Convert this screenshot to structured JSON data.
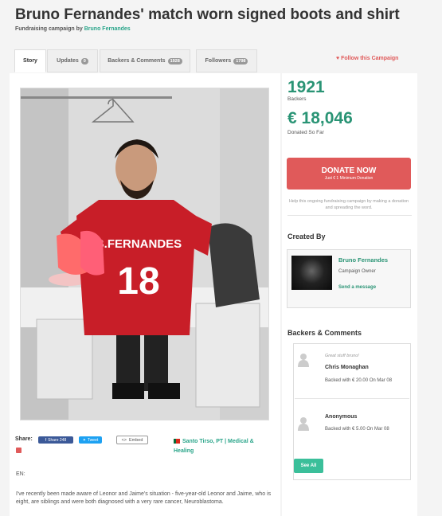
{
  "campaign": {
    "title": "Bruno Fernandes' match worn signed boots and shirt",
    "byline_prefix": "Fundraising campaign by",
    "creator": "Bruno Fernandes"
  },
  "tabs": [
    {
      "label": "Story",
      "badge": ""
    },
    {
      "label": "Updates",
      "badge": "0"
    },
    {
      "label": "Backers & Comments",
      "badge": "1928"
    },
    {
      "label": "Followers",
      "badge": "1798"
    }
  ],
  "follow_label": "Follow this Campaign",
  "hero_jersey": {
    "name": "B.FERNANDES",
    "number": "18"
  },
  "share": {
    "label": "Share:",
    "facebook": "Share 248",
    "twitter": "Tweet",
    "embed": "Embed"
  },
  "location": "Santo Tirso, PT | Medical & Healing",
  "story": {
    "lang": "EN:",
    "text": "I've recently been made aware of Leonor and Jaime's situation - five-year-old Leonor and Jaime, who is eight, are siblings and were both diagnosed with a very rare cancer, Neuroblastoma."
  },
  "stats": {
    "backers": "1921",
    "backers_label": "Backers",
    "donated": "€ 18,046",
    "donated_label": "Donated So Far"
  },
  "donate": {
    "label": "DONATE NOW",
    "sublabel": "Just € 1 Minimum Donation",
    "help": "Help this ongoing fundraising campaign by making a donation and spreading the word."
  },
  "created_by": {
    "heading": "Created By",
    "name": "Bruno Fernandes",
    "role": "Campaign Owner",
    "send": "Send a message"
  },
  "backers_comments": {
    "heading": "Backers & Comments",
    "items": [
      {
        "comment": "Great stuff bruno!",
        "name": "Chris Monaghan",
        "amount": "Backed with € 20.00 On Mar 08"
      },
      {
        "comment": "",
        "name": "Anonymous",
        "amount": "Backed with € 5.00 On Mar 08"
      }
    ],
    "see_all": "See All"
  },
  "colors": {
    "accent": "#2a9475",
    "donate": "#e05a5a",
    "facebook": "#3b5998",
    "twitter": "#1da1f2"
  }
}
